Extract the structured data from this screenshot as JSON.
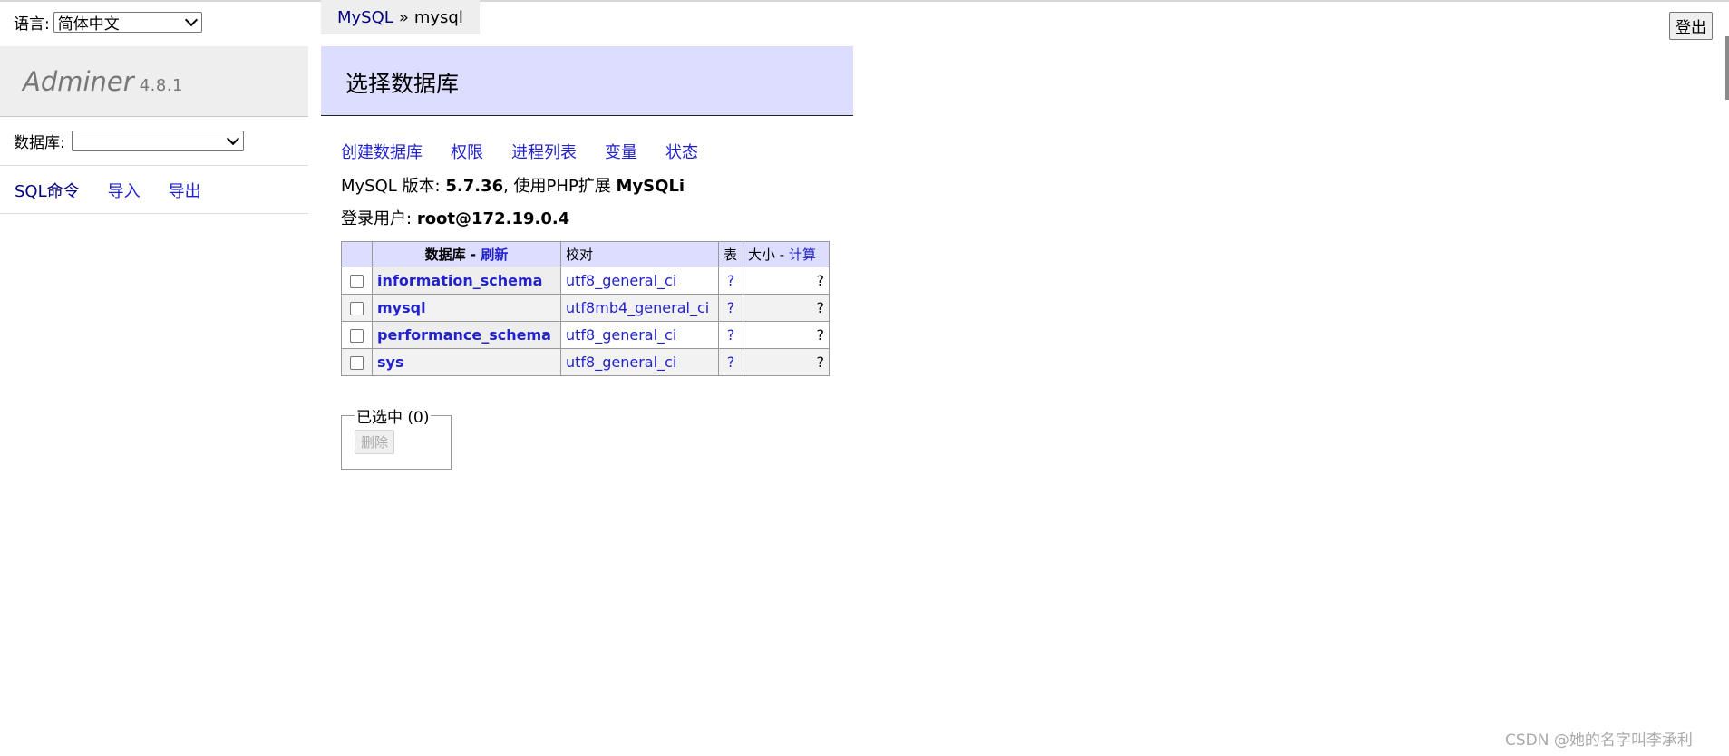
{
  "language": {
    "label": "语言:",
    "selected": "简体中文"
  },
  "logo": {
    "name": "Adminer",
    "version": "4.8.1"
  },
  "db_select": {
    "label": "数据库:",
    "selected": ""
  },
  "sidenav": {
    "sql": "SQL命令",
    "import": "导入",
    "export": "导出"
  },
  "breadcrumb": {
    "root": "MySQL",
    "sep": "»",
    "current": "mysql"
  },
  "page_title": "选择数据库",
  "links": {
    "create": "创建数据库",
    "privileges": "权限",
    "processlist": "进程列表",
    "variables": "变量",
    "status": "状态"
  },
  "info": {
    "version_label": "MySQL 版本:",
    "version": "5.7.36",
    "ext_label": ", 使用PHP扩展",
    "ext": "MySQLi",
    "user_label": "登录用户:",
    "user": "root@172.19.0.4"
  },
  "table": {
    "headers": {
      "database": "数据库",
      "dash1": "-",
      "refresh": "刷新",
      "collation": "校对",
      "tables": "表",
      "size": "大小",
      "dash2": "-",
      "compute": "计算"
    },
    "rows": [
      {
        "name": "information_schema",
        "collation": "utf8_general_ci",
        "tables": "?",
        "size": "?"
      },
      {
        "name": "mysql",
        "collation": "utf8mb4_general_ci",
        "tables": "?",
        "size": "?"
      },
      {
        "name": "performance_schema",
        "collation": "utf8_general_ci",
        "tables": "?",
        "size": "?"
      },
      {
        "name": "sys",
        "collation": "utf8_general_ci",
        "tables": "?",
        "size": "?"
      }
    ]
  },
  "selection": {
    "legend": "已选中 (0)",
    "delete": "删除"
  },
  "logout": "登出",
  "watermark": "CSDN @她的名字叫李承利",
  "colors": {
    "link": "#2222cc",
    "header_bg": "#ddddff",
    "panel_bg": "#eeeeee"
  }
}
